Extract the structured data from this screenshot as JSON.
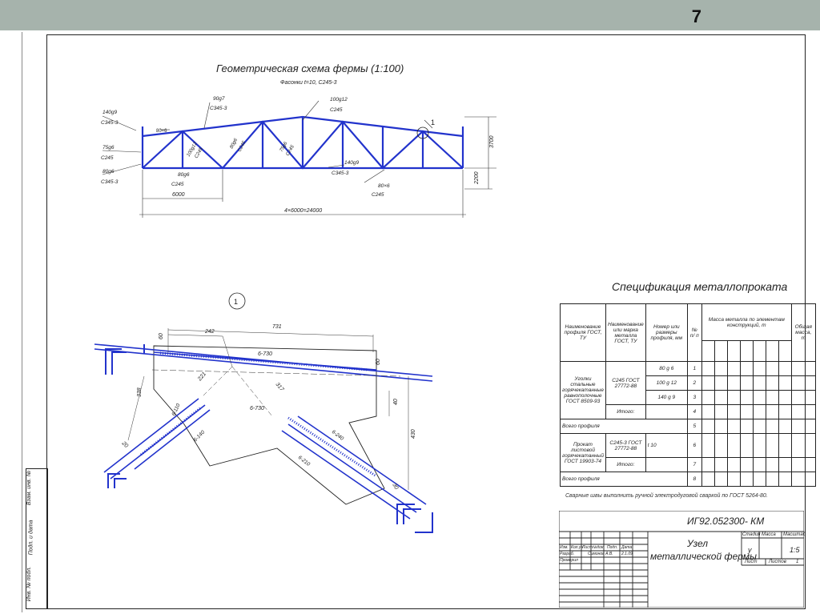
{
  "slide_number": "7",
  "drawing": {
    "geometry_title": "Геометрическая схема фермы (1:100)",
    "gusset_note": "Фасонки t=10, С245-3",
    "labels": {
      "top_left_angle": "140g9",
      "top_left_steel": "С345-3",
      "angle_80x6": "80×6",
      "web_90x7": "90g7",
      "web_90x7_steel": "С345-3",
      "top_100x12": "100g12",
      "top_100x12_steel": "С245",
      "web_100x12": "100g12",
      "web_100x12_steel": "С245",
      "web_80x6": "80g6",
      "web_80x6_steel": "С245",
      "web_75x6": "75g6",
      "web_75x6_steel": "С245",
      "left_75x6": "75g6",
      "left_75x6_steel": "С245",
      "left_80x6": "80g6",
      "left_80x6_steel": "С345-3",
      "bottom_80x6": "80g6",
      "bottom_80x6_steel": "С245",
      "bottom_140x9": "140g9",
      "bottom_140x9_steel": "С345-3",
      "angle_80x6_right": "80×6",
      "angle_80x6_right_steel": "С245",
      "node_callout": "1",
      "height_3700": "3700",
      "height_2200": "2200",
      "span_6000": "6000",
      "span_total": "4×6000=24000"
    },
    "node_detail": {
      "callout": "1",
      "dim_731": "731",
      "dim_242": "242",
      "dim_60_left": "60",
      "dim_60_right": "60",
      "weld_6_730_top": "6-730",
      "weld_6_730_mid": "6-730",
      "dim_221": "221",
      "dim_317": "317",
      "dim_338": "338",
      "dim_40": "40",
      "dim_430": "430",
      "dim_20": "20",
      "dim_30": "30",
      "weld_6_110": "6-110",
      "weld_6_140": "6-140",
      "weld_6_240": "6-240",
      "weld_6_210": "6-210"
    }
  },
  "spec": {
    "title": "Спецификация металлопроката",
    "headers": {
      "profile": "Наименование профиля ГОСТ, ТУ",
      "grade": "Наименование или марка металла ГОСТ, ТУ",
      "size": "Номер или размеры профиля, мм",
      "no": "№ п/ п",
      "mass_by_element": "Масса металла по элементам конструкций, т",
      "total_mass": "Общая масса, т"
    },
    "rows": [
      {
        "profile": "Уголки стальные горячекатанные равнополочные ГОСТ 8509-93",
        "grade": "С245 ГОСТ 27772-88",
        "size": "80 g 6",
        "no": "1"
      },
      {
        "profile": "",
        "grade": "",
        "size": "100 g 12",
        "no": "2"
      },
      {
        "profile": "",
        "grade": "",
        "size": "140 g 9",
        "no": "3"
      },
      {
        "profile": "",
        "grade": "Итого:",
        "size": "",
        "no": "4"
      },
      {
        "profile": "Всего профиля",
        "grade": "",
        "size": "",
        "no": "5"
      },
      {
        "profile": "Прокат листовой горячекатанный ГОСТ 19903-74",
        "grade": "С245-3 ГОСТ 27772-88",
        "size": "t 10",
        "no": "6"
      },
      {
        "profile": "",
        "grade": "Итого:",
        "size": "",
        "no": "7"
      },
      {
        "profile": "Всего профиля",
        "grade": "",
        "size": "",
        "no": "8"
      }
    ]
  },
  "note": "Сварные швы выполнить ручной электродуговой сваркой по ГОСТ 5264-80.",
  "stamp": {
    "code": "ИГ92.052300- КМ",
    "title_line1": "Узел",
    "title_line2": "металлической фермы",
    "stage_label": "Стадия",
    "mass_label": "Масса",
    "scale_label": "Масштаб",
    "stage": "у",
    "scale": "1:5",
    "sheet_label": "Лист",
    "sheets_label": "Листов",
    "sheets_value": "1",
    "col_izm": "Изм.",
    "col_kol": "Кол.уч",
    "col_list": "Лист",
    "col_doc": "№док",
    "col_sign": "Подп.",
    "col_date": "Дата",
    "developed": "Разраб.",
    "developer": "Симонов А.В.",
    "date": "2.1.09",
    "checked": "Проверил"
  },
  "side_strip": {
    "inv_orig": "Инв. № подл.",
    "sign_date": "Подп. и дата",
    "replace_inv": "Взам. инв. №"
  }
}
